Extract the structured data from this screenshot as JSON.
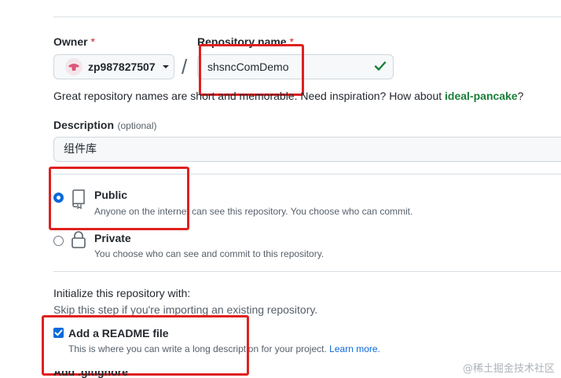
{
  "owner": {
    "label": "Owner",
    "required_mark": "*",
    "username": "zp987827507"
  },
  "repository": {
    "label": "Repository name",
    "required_mark": "*",
    "value": "shsncComDemo",
    "separator": "/"
  },
  "name_hint": {
    "text": "Great repository names are short and memorable. Need inspiration? How about",
    "suggestion": "ideal-pancake",
    "suffix": "?"
  },
  "description": {
    "label": "Description",
    "optional": "(optional)",
    "value": "组件库"
  },
  "visibility": {
    "public": {
      "title": "Public",
      "subtitle": "Anyone on the internet can see this repository. You choose who can commit.",
      "selected": true
    },
    "private": {
      "title": "Private",
      "subtitle": "You choose who can see and commit to this repository.",
      "selected": false
    }
  },
  "initialize": {
    "heading": "Initialize this repository with:",
    "subheading": "Skip this step if you're importing an existing repository.",
    "readme": {
      "label": "Add a README file",
      "description": "This is where you can write a long description for your project.",
      "link": "Learn more.",
      "checked": true
    },
    "next_section_partial": "Add .gitignore"
  },
  "watermark": "@稀土掘金技术社区",
  "colors": {
    "accent": "#0969da",
    "success": "#1a7f37",
    "required": "#cf222e",
    "annotation": "#e02020"
  }
}
